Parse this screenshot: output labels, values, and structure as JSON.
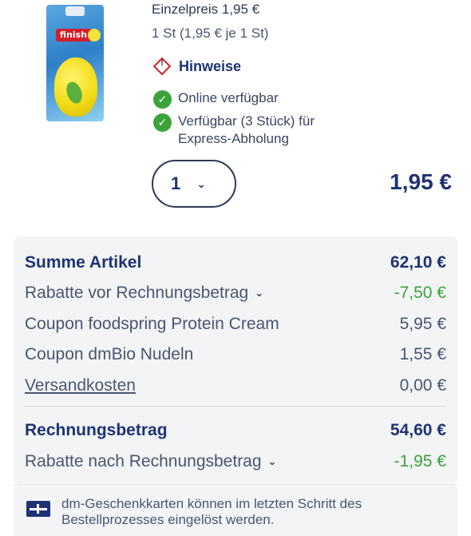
{
  "product": {
    "image_brand": "finish",
    "unit_price": "Einzelpreis 1,95 €",
    "quantity_info": "1 St (1,95 € je 1 St)",
    "hinweise_label": "Hinweise",
    "availability": [
      {
        "text": "Online verfügbar"
      },
      {
        "text": "Verfügbar (3 Stück) für Express-Abholung"
      }
    ],
    "quantity_value": "1",
    "line_total": "1,95 €"
  },
  "summary": {
    "summe_artikel": {
      "label": "Summe Artikel",
      "value": "62,10 €"
    },
    "rabatte_vor": {
      "label": "Rabatte vor Rechnungsbetrag",
      "value": "-7,50 €"
    },
    "coupon_1": {
      "label": "Coupon foodspring Protein Cream",
      "value": "5,95 €"
    },
    "coupon_2": {
      "label": "Coupon dmBio Nudeln",
      "value": "1,55 €"
    },
    "versandkosten": {
      "label": "Versandkosten",
      "value": "0,00 €"
    },
    "rechnungsbetrag": {
      "label": "Rechnungsbetrag",
      "value": "54,60 €"
    },
    "rabatte_nach": {
      "label": "Rabatte nach Rechnungsbetrag",
      "value": "-1,95 €"
    }
  },
  "giftcard_note": "dm-Geschenkkarten können im letzten Schritt des Bestellprozesses eingelöst werden.",
  "icons": {
    "hazard": "hazard-warning-icon",
    "check": "check-circle-icon",
    "chevron": "chevron-down-icon",
    "giftcard": "gift-card-icon"
  },
  "colors": {
    "primary": "#1f3373",
    "success": "#3aa33a",
    "hazard": "#d0232b",
    "summary_bg": "#f3f4f6"
  }
}
